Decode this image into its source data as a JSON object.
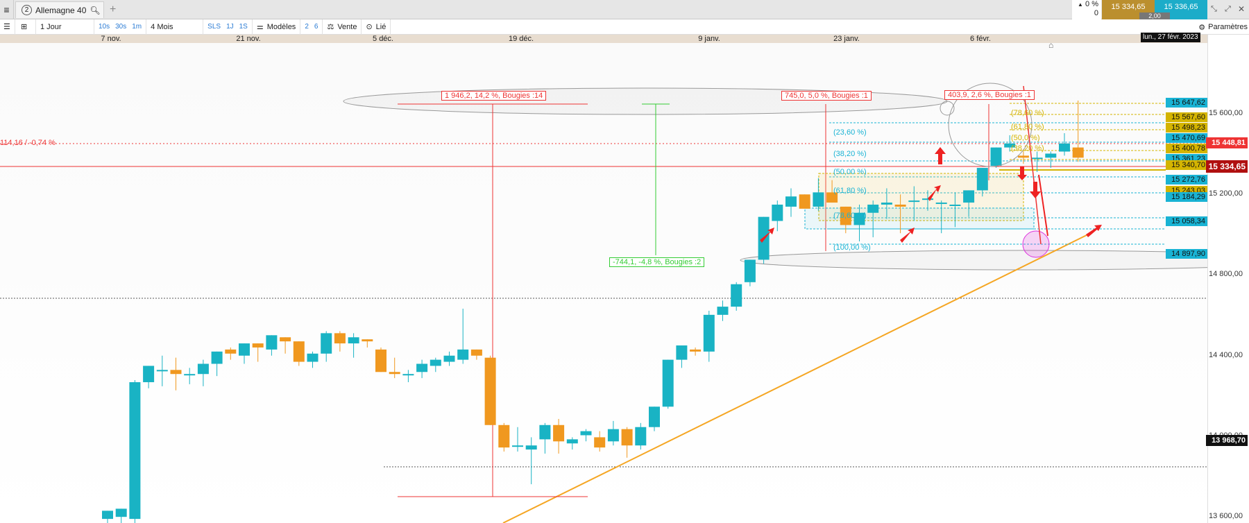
{
  "app": {
    "menu_icon": "hamburger-icon",
    "tab": {
      "number": "2",
      "title": "Allemagne 40"
    },
    "add_tab": "+",
    "change": {
      "pct": "0 %",
      "value": "0"
    },
    "bid": "15 334,65",
    "ask": "15 336,65",
    "spread": "2,00"
  },
  "toolbar": {
    "period": "1 Jour",
    "intervals": [
      "10s",
      "30s",
      "1m"
    ],
    "range": "4 Mois",
    "quick": [
      "SLS",
      "1J",
      "1S"
    ],
    "models": "Modèles",
    "n1": "2",
    "n2": "6",
    "sell": "Vente",
    "linked": "Lié",
    "settings": "Paramètres"
  },
  "date_axis": {
    "labels": [
      "7 nov.",
      "21 nov.",
      "5 déc.",
      "19 déc.",
      "9 janv.",
      "23 janv.",
      "6 févr."
    ],
    "crosshair": "lun., 27 févr. 2023"
  },
  "price_axis": {
    "ticks": [
      "15 600,00",
      "15 200,00",
      "14 800,00",
      "14 400,00",
      "14 000,00",
      "13 600,00"
    ],
    "tags": [
      {
        "text": "15 647,62",
        "color": "#19b3d4"
      },
      {
        "text": "15 567,60",
        "color": "#d4b400"
      },
      {
        "text": "15 498,23",
        "color": "#d4b400"
      },
      {
        "text": "15 470,69",
        "color": "#19b3d4"
      },
      {
        "text": "15 400,78",
        "color": "#d4b400"
      },
      {
        "text": "15 361,23",
        "color": "#19b3d4"
      },
      {
        "text": "15 340,70",
        "color": "#d4b400"
      },
      {
        "text": "15 272,76",
        "color": "#19b3d4"
      },
      {
        "text": "15 243,03",
        "color": "#d4b400"
      },
      {
        "text": "15 184,29",
        "color": "#19b3d4"
      },
      {
        "text": "15 058,34",
        "color": "#19b3d4"
      },
      {
        "text": "14 897,90",
        "color": "#19b3d4"
      }
    ],
    "current": "15 334,65",
    "alert": "15 448,81",
    "crosshair_price": "13 968,70"
  },
  "annotations": {
    "alert_line": "114,16 / -0,74 %",
    "measure1": "1 946,2, 14,2 %, Bougies :14",
    "measure2": "-744,1, -4,8 %, Bougies :2",
    "measure3": "745,0, 5,0 %, Bougies :1",
    "measure4": "403,9, 2,6 %, Bougies :1",
    "fib_left": [
      "(23,60 %)",
      "(38,20 %)",
      "(50,00 %)",
      "(61,80 %)",
      "(78,60 %)",
      "(100,00 %)"
    ],
    "fib_right": [
      "(78,60 %)",
      "(61,80 %)",
      "(50,0 %)",
      "(38,20 %)"
    ]
  },
  "chart_data": {
    "type": "candlestick",
    "ylim": [
      13580,
      15660
    ],
    "candles": [
      {
        "o": 13600,
        "h": 13640,
        "l": 13580,
        "c": 13640
      },
      {
        "o": 13610,
        "h": 13650,
        "l": 13580,
        "c": 13650
      },
      {
        "o": 13600,
        "h": 14280,
        "l": 13580,
        "c": 14270
      },
      {
        "o": 14270,
        "h": 14350,
        "l": 14240,
        "c": 14350
      },
      {
        "o": 14330,
        "h": 14400,
        "l": 14250,
        "c": 14330
      },
      {
        "o": 14330,
        "h": 14390,
        "l": 14230,
        "c": 14310
      },
      {
        "o": 14310,
        "h": 14340,
        "l": 14260,
        "c": 14310
      },
      {
        "o": 14310,
        "h": 14380,
        "l": 14250,
        "c": 14360
      },
      {
        "o": 14360,
        "h": 14420,
        "l": 14300,
        "c": 14420
      },
      {
        "o": 14430,
        "h": 14440,
        "l": 14380,
        "c": 14410
      },
      {
        "o": 14400,
        "h": 14460,
        "l": 14360,
        "c": 14460
      },
      {
        "o": 14460,
        "h": 14440,
        "l": 14370,
        "c": 14440
      },
      {
        "o": 14430,
        "h": 14500,
        "l": 14400,
        "c": 14500
      },
      {
        "o": 14490,
        "h": 14470,
        "l": 14410,
        "c": 14470
      },
      {
        "o": 14470,
        "h": 14420,
        "l": 14350,
        "c": 14370
      },
      {
        "o": 14370,
        "h": 14420,
        "l": 14340,
        "c": 14410
      },
      {
        "o": 14410,
        "h": 14520,
        "l": 14370,
        "c": 14510
      },
      {
        "o": 14510,
        "h": 14520,
        "l": 14420,
        "c": 14460
      },
      {
        "o": 14460,
        "h": 14510,
        "l": 14390,
        "c": 14490
      },
      {
        "o": 14480,
        "h": 14480,
        "l": 14440,
        "c": 14470
      },
      {
        "o": 14430,
        "h": 14440,
        "l": 14320,
        "c": 14320
      },
      {
        "o": 14320,
        "h": 14390,
        "l": 14290,
        "c": 14310
      },
      {
        "o": 14310,
        "h": 14330,
        "l": 14270,
        "c": 14310
      },
      {
        "o": 14320,
        "h": 14380,
        "l": 14290,
        "c": 14360
      },
      {
        "o": 14350,
        "h": 14390,
        "l": 14320,
        "c": 14380
      },
      {
        "o": 14370,
        "h": 14420,
        "l": 14350,
        "c": 14400
      },
      {
        "o": 14380,
        "h": 14630,
        "l": 14360,
        "c": 14430
      },
      {
        "o": 14430,
        "h": 14430,
        "l": 14380,
        "c": 14400
      },
      {
        "o": 14390,
        "h": 14400,
        "l": 14060,
        "c": 14060
      },
      {
        "o": 14060,
        "h": 14070,
        "l": 13930,
        "c": 13950
      },
      {
        "o": 13960,
        "h": 14050,
        "l": 13930,
        "c": 13960
      },
      {
        "o": 13940,
        "h": 14000,
        "l": 13770,
        "c": 13960
      },
      {
        "o": 13990,
        "h": 14070,
        "l": 13920,
        "c": 14060
      },
      {
        "o": 14060,
        "h": 14090,
        "l": 13920,
        "c": 13980
      },
      {
        "o": 13970,
        "h": 14000,
        "l": 13940,
        "c": 13990
      },
      {
        "o": 14010,
        "h": 14040,
        "l": 13980,
        "c": 14030
      },
      {
        "o": 14000,
        "h": 14030,
        "l": 13930,
        "c": 13950
      },
      {
        "o": 13980,
        "h": 14080,
        "l": 13960,
        "c": 14040
      },
      {
        "o": 14040,
        "h": 14050,
        "l": 13900,
        "c": 13960
      },
      {
        "o": 13960,
        "h": 14070,
        "l": 13940,
        "c": 14050
      },
      {
        "o": 14050,
        "h": 14150,
        "l": 14030,
        "c": 14150
      },
      {
        "o": 14150,
        "h": 14380,
        "l": 14140,
        "c": 14380
      },
      {
        "o": 14380,
        "h": 14450,
        "l": 14340,
        "c": 14450
      },
      {
        "o": 14430,
        "h": 14440,
        "l": 14400,
        "c": 14420
      },
      {
        "o": 14420,
        "h": 14620,
        "l": 14370,
        "c": 14600
      },
      {
        "o": 14600,
        "h": 14670,
        "l": 14570,
        "c": 14640
      },
      {
        "o": 14640,
        "h": 14760,
        "l": 14620,
        "c": 14750
      },
      {
        "o": 14760,
        "h": 14870,
        "l": 14740,
        "c": 14870
      },
      {
        "o": 14870,
        "h": 15080,
        "l": 14850,
        "c": 15080
      },
      {
        "o": 15060,
        "h": 15160,
        "l": 15010,
        "c": 15140
      },
      {
        "o": 15130,
        "h": 15220,
        "l": 15080,
        "c": 15180
      },
      {
        "o": 15190,
        "h": 15180,
        "l": 15120,
        "c": 15120
      },
      {
        "o": 15130,
        "h": 15270,
        "l": 15110,
        "c": 15200
      },
      {
        "o": 15200,
        "h": 15260,
        "l": 15150,
        "c": 15150
      },
      {
        "o": 15130,
        "h": 15120,
        "l": 15000,
        "c": 15040
      },
      {
        "o": 15040,
        "h": 15140,
        "l": 14960,
        "c": 15100
      },
      {
        "o": 15100,
        "h": 15160,
        "l": 14980,
        "c": 15140
      },
      {
        "o": 15140,
        "h": 15220,
        "l": 15070,
        "c": 15150
      },
      {
        "o": 15140,
        "h": 15190,
        "l": 15000,
        "c": 15130
      },
      {
        "o": 15160,
        "h": 15230,
        "l": 15060,
        "c": 15160
      },
      {
        "o": 15170,
        "h": 15210,
        "l": 15110,
        "c": 15170
      },
      {
        "o": 15150,
        "h": 15160,
        "l": 15000,
        "c": 15150
      },
      {
        "o": 15140,
        "h": 15200,
        "l": 15030,
        "c": 15140
      },
      {
        "o": 15150,
        "h": 15210,
        "l": 15080,
        "c": 15210
      },
      {
        "o": 15210,
        "h": 15320,
        "l": 15180,
        "c": 15320
      },
      {
        "o": 15330,
        "h": 15420,
        "l": 15320,
        "c": 15420
      },
      {
        "o": 15420,
        "h": 15480,
        "l": 15400,
        "c": 15440
      },
      {
        "o": 15380,
        "h": 15400,
        "l": 15340,
        "c": 15370
      },
      {
        "o": 15370,
        "h": 15400,
        "l": 15300,
        "c": 15370
      },
      {
        "o": 15370,
        "h": 15400,
        "l": 15320,
        "c": 15390
      },
      {
        "o": 15400,
        "h": 15490,
        "l": 15380,
        "c": 15440
      },
      {
        "o": 15420,
        "h": 15650,
        "l": 15350,
        "c": 15370
      }
    ]
  }
}
